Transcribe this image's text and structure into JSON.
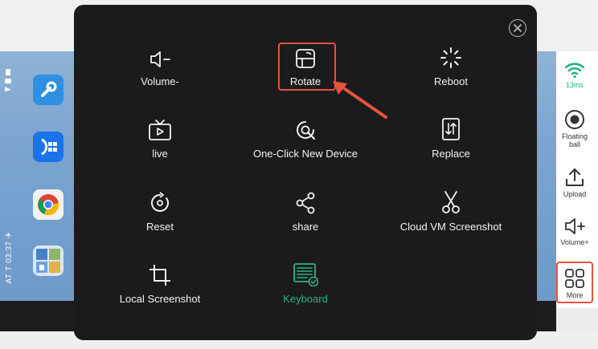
{
  "phone": {
    "status_time": "AT T 03:37 ✈"
  },
  "right_bar": {
    "wifi_latency": "13ms",
    "floating_ball_label": "Floating ball",
    "upload_label": "Upload",
    "volume_plus_label": "Volume+",
    "more_label": "More"
  },
  "modal": {
    "tiles": [
      {
        "label": "Volume-",
        "icon": "volume-down-icon"
      },
      {
        "label": "Rotate",
        "icon": "rotate-icon"
      },
      {
        "label": "Reboot",
        "icon": "reboot-icon"
      },
      {
        "label": "live",
        "icon": "tv-icon"
      },
      {
        "label": "One-Click New Device",
        "icon": "new-device-icon"
      },
      {
        "label": "Replace",
        "icon": "replace-icon"
      },
      {
        "label": "Reset",
        "icon": "reset-icon"
      },
      {
        "label": "share",
        "icon": "share-icon"
      },
      {
        "label": "Cloud VM Screenshot",
        "icon": "scissors-icon"
      },
      {
        "label": "Local Screenshot",
        "icon": "crop-icon"
      },
      {
        "label": "Keyboard",
        "icon": "keyboard-icon"
      }
    ]
  },
  "colors": {
    "modal_bg": "#1b1b1d",
    "accent_green": "#27b67e",
    "highlight_red": "#e5533d"
  }
}
